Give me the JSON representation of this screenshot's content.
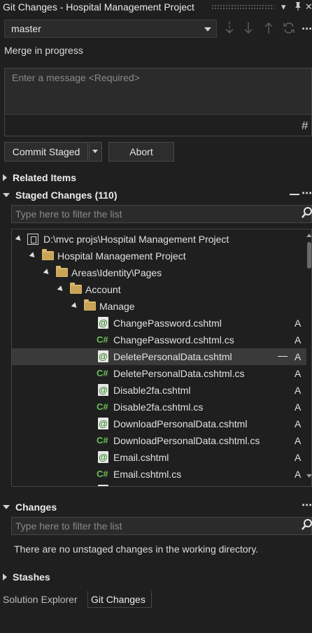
{
  "window": {
    "title": "Git Changes - Hospital Management Project"
  },
  "branch": {
    "name": "master",
    "status": "Merge in progress"
  },
  "message": {
    "placeholder": "Enter a message <Required>"
  },
  "actions": {
    "commit_label": "Commit Staged",
    "abort_label": "Abort"
  },
  "sections": {
    "related": "Related Items",
    "staged": "Staged Changes (110)",
    "changes": "Changes",
    "stashes": "Stashes"
  },
  "filters": {
    "staged_placeholder": "Type here to filter the list",
    "changes_placeholder": "Type here to filter the list"
  },
  "tree": {
    "root": "D:\\mvc projs\\Hospital Management Project",
    "project": "Hospital Management Project",
    "pages": "Areas\\Identity\\Pages",
    "account": "Account",
    "manage": "Manage",
    "files": [
      {
        "name": "ChangePassword.cshtml",
        "type": "cshtml",
        "status": "A"
      },
      {
        "name": "ChangePassword.cshtml.cs",
        "type": "cs",
        "status": "A"
      },
      {
        "name": "DeletePersonalData.cshtml",
        "type": "cshtml",
        "status": "A",
        "selected": true
      },
      {
        "name": "DeletePersonalData.cshtml.cs",
        "type": "cs",
        "status": "A"
      },
      {
        "name": "Disable2fa.cshtml",
        "type": "cshtml",
        "status": "A"
      },
      {
        "name": "Disable2fa.cshtml.cs",
        "type": "cs",
        "status": "A"
      },
      {
        "name": "DownloadPersonalData.cshtml",
        "type": "cshtml",
        "status": "A"
      },
      {
        "name": "DownloadPersonalData.cshtml.cs",
        "type": "cs",
        "status": "A"
      },
      {
        "name": "Email.cshtml",
        "type": "cshtml",
        "status": "A"
      },
      {
        "name": "Email.cshtml.cs",
        "type": "cs",
        "status": "A"
      }
    ]
  },
  "changes": {
    "empty_message": "There are no unstaged changes in the working directory."
  },
  "tabs": {
    "solution": "Solution Explorer",
    "git": "Git Changes"
  },
  "icons": {
    "csharp_glyph": "C#",
    "razor_glyph": "@",
    "status_minus": "—"
  },
  "colors": {
    "background": "#1f1f1f",
    "folder": "#d8b66a",
    "csharp": "#6cc05b"
  }
}
